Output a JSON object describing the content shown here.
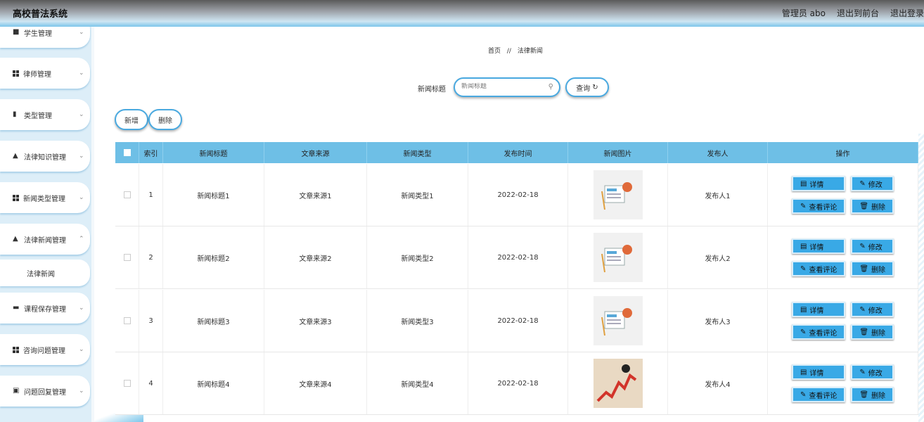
{
  "header": {
    "title": "高校普法系统",
    "admin_label": "管理员 abo",
    "exit_front": "退出到前台",
    "logout": "退出登录"
  },
  "sidebar": {
    "items": [
      {
        "label": "学生管理",
        "icon": "user-icon"
      },
      {
        "label": "律师管理",
        "icon": "grid-icon"
      },
      {
        "label": "类型管理",
        "icon": "book-icon"
      },
      {
        "label": "法律知识管理",
        "icon": "user-icon"
      },
      {
        "label": "新闻类型管理",
        "icon": "grid-icon"
      },
      {
        "label": "法律新闻管理",
        "icon": "user-icon"
      },
      {
        "label": "课程保存管理",
        "icon": "chat-icon"
      },
      {
        "label": "咨询问题管理",
        "icon": "grid-icon"
      },
      {
        "label": "问题回复管理",
        "icon": "folder-icon"
      }
    ],
    "sub_item": "法律新闻"
  },
  "breadcrumb": {
    "home": "首页",
    "separator": "//",
    "current": "法律新闻"
  },
  "search": {
    "label": "新闻标题",
    "placeholder": "新闻标题",
    "query_button": "查询"
  },
  "toolbar": {
    "add": "新增",
    "delete": "删除"
  },
  "table": {
    "headers": [
      "索引",
      "新闻标题",
      "文章来源",
      "新闻类型",
      "发布时间",
      "新闻图片",
      "发布人",
      "操作"
    ],
    "rows": [
      {
        "index": "1",
        "title": "新闻标题1",
        "source": "文章来源1",
        "type": "新闻类型1",
        "time": "2022-02-18",
        "publisher": "发布人1",
        "image": "news-icon"
      },
      {
        "index": "2",
        "title": "新闻标题2",
        "source": "文章来源2",
        "type": "新闻类型2",
        "time": "2022-02-18",
        "publisher": "发布人2",
        "image": "news-icon"
      },
      {
        "index": "3",
        "title": "新闻标题3",
        "source": "文章来源3",
        "type": "新闻类型3",
        "time": "2022-02-18",
        "publisher": "发布人3",
        "image": "news-icon"
      },
      {
        "index": "4",
        "title": "新闻标题4",
        "source": "文章来源4",
        "type": "新闻类型4",
        "time": "2022-02-18",
        "publisher": "发布人4",
        "image": "chart-crash-icon"
      }
    ],
    "actions": {
      "detail": "详情",
      "edit": "修改",
      "comments": "查看评论",
      "delete": "删除"
    }
  },
  "colors": {
    "accent": "#39a9e6",
    "header_row": "#6ebfe6",
    "sidebar_bg": "#ddeef8"
  }
}
